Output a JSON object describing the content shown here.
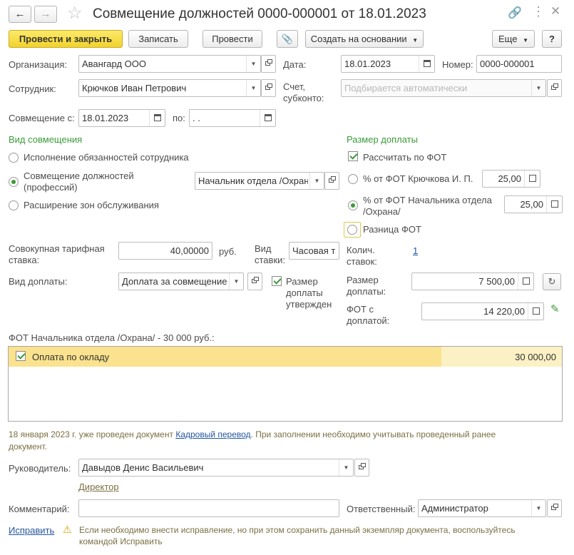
{
  "window": {
    "title": "Совмещение должностей 0000-000001 от 18.01.2023"
  },
  "toolbar": {
    "post_close": "Провести и закрыть",
    "save": "Записать",
    "post": "Провести",
    "create_based": "Создать на основании",
    "more": "Еще",
    "help": "?"
  },
  "header": {
    "org_label": "Организация:",
    "org_value": "Авангард ООО",
    "date_label": "Дата:",
    "date_value": "18.01.2023",
    "number_label": "Номер:",
    "number_value": "0000-000001",
    "employee_label": "Сотрудник:",
    "employee_value": "Крючков Иван Петрович",
    "account_label_1": "Счет,",
    "account_label_2": "субконто:",
    "account_placeholder": "Подбирается автоматически",
    "from_label": "Совмещение с:",
    "from_value": "18.01.2023",
    "to_label": "по:",
    "to_value": " .  ."
  },
  "combination": {
    "title": "Вид совмещения",
    "opt1": "Исполнение обязанностей сотрудника",
    "opt2_line1": "Совмещение должностей",
    "opt2_line2": "(профессий)",
    "opt3": "Расширение зон обслуживания",
    "position_value": "Начальник отдела /Охрана/"
  },
  "payment": {
    "title": "Размер доплаты",
    "calc_fot": "Рассчитать по ФОТ",
    "pct_fot_1": "% от ФОТ Крючкова И. П.",
    "pct_fot_1_value": "25,00",
    "pct_fot_2_line1": "% от ФОТ Начальника отдела",
    "pct_fot_2_line2": "/Охрана/",
    "pct_fot_2_value": "25,00",
    "diff_fot": "Разница ФОТ",
    "count_label_1": "Колич.",
    "count_label_2": "ставок:",
    "count_value": "1",
    "size_label_1": "Размер",
    "size_label_2": "доплаты:",
    "size_value": "7 500,00",
    "fot_label_1": "ФОТ с",
    "fot_label_2": "доплатой:",
    "fot_value": "14 220,00"
  },
  "rates": {
    "tariff_label_1": "Совокупная тарифная",
    "tariff_label_2": "ставка:",
    "tariff_value": "40,00000",
    "currency": "руб.",
    "rate_kind_label_1": "Вид",
    "rate_kind_label_2": "ставки:",
    "rate_kind_value": "Часовая тарифная ставка",
    "pay_kind_label": "Вид доплаты:",
    "pay_kind_value": "Доплата за совмещение должностей",
    "approved_1": "Размер",
    "approved_2": "доплаты",
    "approved_3": "утвержден"
  },
  "fot_table": {
    "caption": "ФОТ Начальника отдела /Охрана/ - 30 000 руб.:",
    "rows": [
      {
        "name": "Оплата по окладу",
        "amount": "30 000,00"
      }
    ]
  },
  "notice": {
    "line1_before": "18 января 2023 г. уже проведен документ ",
    "link": "Кадровый перевод",
    "line1_after": ". При заполнении необходимо учитывать проведенный ранее",
    "line2": "документ."
  },
  "footer": {
    "manager_label": "Руководитель:",
    "manager_value": "Давыдов Денис Васильевич",
    "manager_position": "Директор",
    "comment_label": "Комментарий:",
    "comment_value": "",
    "responsible_label": "Ответственный:",
    "responsible_value": "Администратор",
    "fix_link": "Исправить",
    "warning_line1": "Если необходимо внести исправление, но при этом сохранить данный экземпляр документа, воспользуйтесь",
    "warning_line2": "командой Исправить"
  }
}
